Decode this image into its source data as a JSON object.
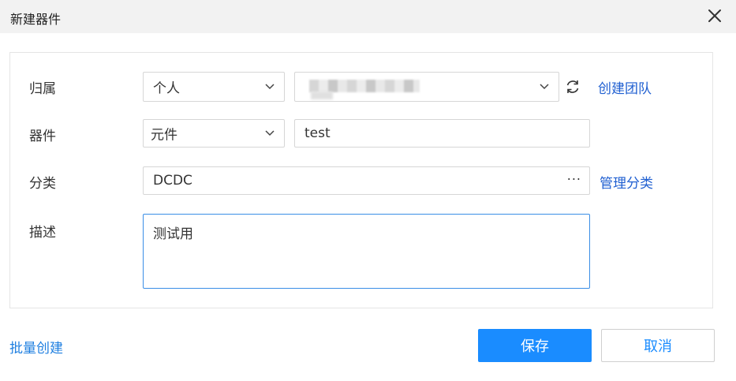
{
  "dialog": {
    "title": "新建器件"
  },
  "form": {
    "owner": {
      "label": "归属",
      "select_value": "个人",
      "team_select_value": "",
      "create_team_link": "创建团队"
    },
    "device": {
      "label": "器件",
      "type_value": "元件",
      "name_value": "test"
    },
    "category": {
      "label": "分类",
      "value": "DCDC",
      "more": "···",
      "manage_link": "管理分类"
    },
    "description": {
      "label": "描述",
      "value": "测试用"
    }
  },
  "footer": {
    "batch_create": "批量创建",
    "save": "保存",
    "cancel": "取消"
  },
  "colors": {
    "primary": "#1a8cff",
    "link": "#1f5fd1",
    "titlebar": "#f2f2f2",
    "focus_border": "#3a8ee6"
  },
  "icons": [
    "close-icon",
    "chevron-down-icon",
    "refresh-icon",
    "more-icon"
  ]
}
